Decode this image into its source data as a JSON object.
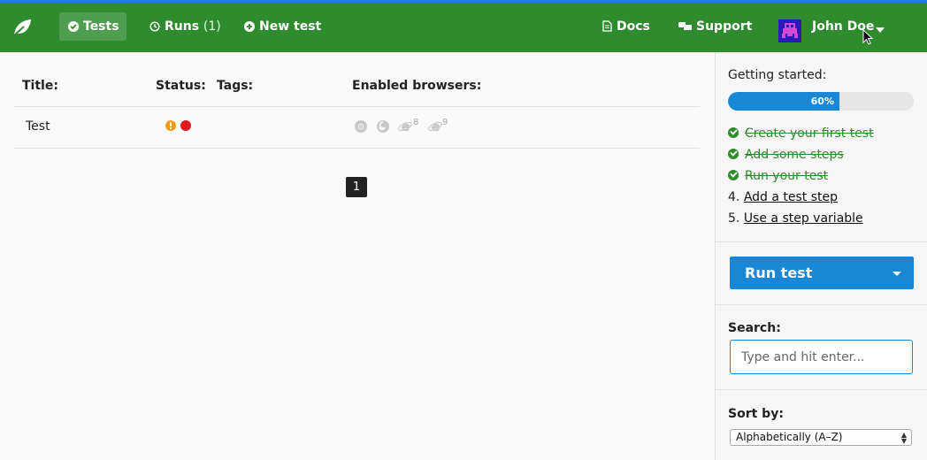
{
  "colors": {
    "nav_bg": "#2e8b2e",
    "accent_blue": "#1a86d6",
    "done_green": "#2e8b2e",
    "status_warning": "#f59a0c",
    "status_error": "#e0191e"
  },
  "nav": {
    "tests_label": "Tests",
    "runs_label": "Runs",
    "runs_count": "(1)",
    "new_test_label": "New test",
    "docs_label": "Docs",
    "support_label": "Support",
    "user_name": "John Doe"
  },
  "table": {
    "headers": {
      "title": "Title:",
      "status": "Status:",
      "tags": "Tags:",
      "browsers": "Enabled browsers:"
    },
    "rows": [
      {
        "title": "Test",
        "status_icons": [
          "warning-icon",
          "error-dot-icon"
        ],
        "browsers": [
          {
            "icon": "chrome-icon",
            "version": ""
          },
          {
            "icon": "firefox-icon",
            "version": ""
          },
          {
            "icon": "ie-icon",
            "version": "8"
          },
          {
            "icon": "ie-icon",
            "version": "9"
          }
        ]
      }
    ],
    "pagination": {
      "current_page": "1"
    }
  },
  "sidebar": {
    "getting_started_label": "Getting started:",
    "progress": {
      "percent": 60,
      "label": "60%"
    },
    "steps": [
      {
        "text": "Create your first test",
        "done": true
      },
      {
        "text": "Add some steps",
        "done": true
      },
      {
        "text": "Run your test",
        "done": true
      },
      {
        "number": "4.",
        "text": "Add a test step",
        "done": false
      },
      {
        "number": "5.",
        "text": "Use a step variable",
        "done": false
      }
    ],
    "run_button_label": "Run test",
    "search": {
      "label": "Search:",
      "placeholder": "Type and hit enter..."
    },
    "sort": {
      "label": "Sort by:",
      "selected": "Alphabetically (A–Z)"
    }
  }
}
